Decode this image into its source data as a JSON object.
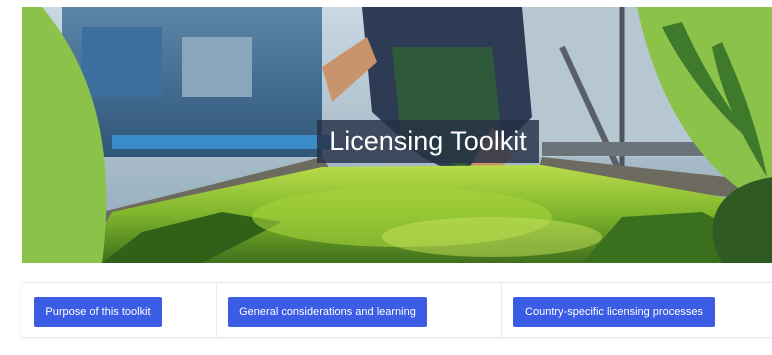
{
  "hero": {
    "title": "Licensing Toolkit",
    "image": "photo-seaweed-harvest-boat"
  },
  "nav": {
    "buttons": [
      {
        "label": "Purpose of this toolkit"
      },
      {
        "label": "General considerations and learning"
      },
      {
        "label": "Country-specific licensing processes"
      }
    ]
  },
  "colors": {
    "button": "#3b5ce5",
    "leaf_green": "#8bc34a",
    "title_overlay": "#263046"
  }
}
